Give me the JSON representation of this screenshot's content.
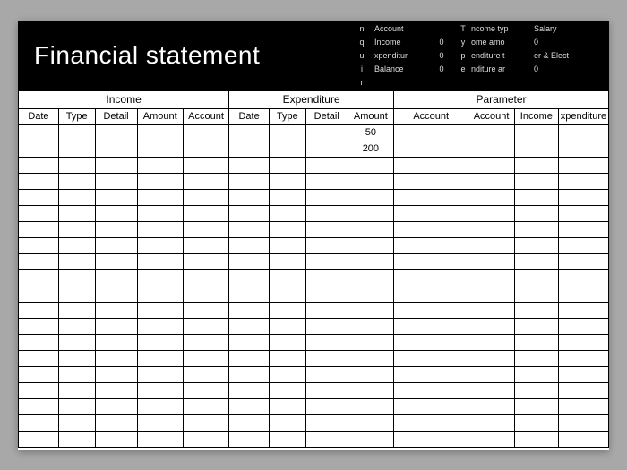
{
  "title": "Financial statement",
  "inquiry_label": [
    "n",
    "q",
    "u",
    "i",
    "r"
  ],
  "summary": {
    "rows": [
      {
        "label": "Account",
        "value": ""
      },
      {
        "label": "Income",
        "value": "0"
      },
      {
        "label": "xpenditur",
        "value": "0"
      },
      {
        "label": "Balance",
        "value": "0"
      }
    ],
    "type_label": [
      "T",
      "y",
      "p",
      "e"
    ],
    "type_rows": [
      {
        "label": "ncome typ",
        "value": "Salary"
      },
      {
        "label": "ome amo",
        "value": "0"
      },
      {
        "label": "enditure t",
        "value": "er & Elect"
      },
      {
        "label": "nditure ar",
        "value": "0"
      }
    ]
  },
  "sections": {
    "income": "Income",
    "expenditure": "Expenditure",
    "parameter": "Parameter"
  },
  "columns": {
    "date": "Date",
    "type": "Type",
    "detail": "Detail",
    "amount": "Amount",
    "account": "Account",
    "paccount": "Account",
    "pacc2": "Account",
    "pincome": "Income",
    "pexp": "xpenditure"
  },
  "chart_data": {
    "type": "table",
    "columns": [
      "Income.Date",
      "Income.Type",
      "Income.Detail",
      "Income.Amount",
      "Income.Account",
      "Expenditure.Date",
      "Expenditure.Type",
      "Expenditure.Detail",
      "Expenditure.Amount",
      "Parameter.Account",
      "Parameter.Account2",
      "Parameter.Income",
      "Parameter.Expenditure"
    ],
    "rows": [
      [
        "",
        "",
        "",
        "",
        "",
        "",
        "",
        "",
        "50",
        "",
        "",
        "",
        ""
      ],
      [
        "",
        "",
        "",
        "",
        "",
        "",
        "",
        "",
        "200",
        "",
        "",
        "",
        ""
      ]
    ]
  },
  "amounts": [
    "50",
    "200"
  ],
  "empty_rows": 20
}
